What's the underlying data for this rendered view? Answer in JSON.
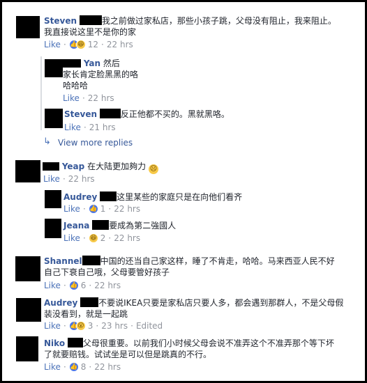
{
  "like_label": "Like",
  "view_more": "View more replies",
  "comments": [
    {
      "name": "Steven",
      "line1": "我之前做过家私店，那些小孩子跳，父母没有阻止，我来阻止。",
      "line2": "我直接说这里不是你的家",
      "reactions": [
        "like-icon",
        "haha-icon"
      ],
      "count": "12",
      "time": "22 hrs"
    },
    {
      "name": "Yan",
      "line1": "然后",
      "line2": "家长肯定脸黑黑的咯",
      "line3": "哈哈哈",
      "time": "22 hrs"
    },
    {
      "name": "Steven",
      "line1": "反正他都不买的。黑就黑咯。",
      "time": "21 hrs"
    },
    {
      "name": "Yeap",
      "line1": "在大陆更加夠力",
      "emoji": "sad-face-icon",
      "time": "22 hrs"
    },
    {
      "name": "Audrey",
      "line1": "这里某些的家庭只是在向他们看齐",
      "reactions": [
        "like-icon"
      ],
      "count": "1",
      "time": "22 hrs"
    },
    {
      "name": "Jeana",
      "line1": "要成為第二強國人",
      "reactions": [
        "haha-icon"
      ],
      "count": "2",
      "time": "22 hrs"
    },
    {
      "name": "Shannel",
      "line1": "中国的还当自己家这样，睡了不肯走，哈哈。马来西亚人民不好",
      "line2": "自己下衰自己哦，父母要管好孩子",
      "reactions": [
        "like-icon"
      ],
      "count": "6",
      "time": "22 hrs"
    },
    {
      "name": "Audrey",
      "line1": "不要说IKEA只要是家私店只要人多，都会遇到那群人，不是父母假",
      "line2": "装没看到，就是一起跳",
      "reactions": [
        "like-icon",
        "wow-icon"
      ],
      "count": "3",
      "time": "23 hrs",
      "edited": "Edited"
    },
    {
      "name": "Niko",
      "line1": "父母很重要。以前我们小时候父母会说不准弄这个不准弄那个等下坏",
      "line2": "了就要赔钱。试试坐是可以但是跳真的不行。",
      "reactions": [
        "like-icon"
      ],
      "count": "8",
      "time": "22 hrs"
    }
  ]
}
